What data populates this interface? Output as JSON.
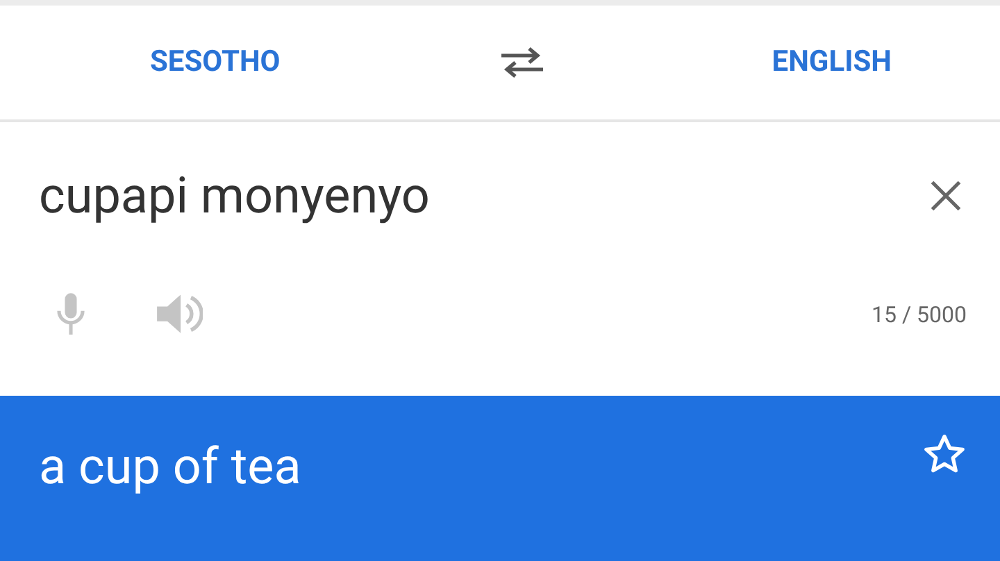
{
  "languages": {
    "source": "SESOTHO",
    "target": "ENGLISH"
  },
  "input": {
    "value": "cupapi monyenyo",
    "counter": "15 / 5000"
  },
  "output": {
    "text": "a cup of tea",
    "starred": false
  }
}
